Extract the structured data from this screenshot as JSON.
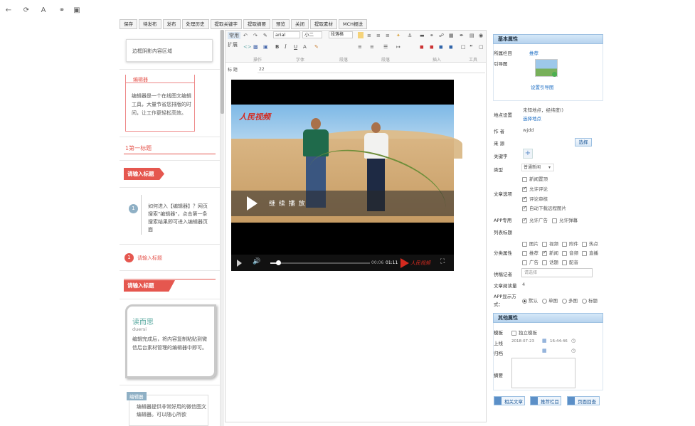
{
  "browser": {
    "icons": [
      "back-arrow-icon",
      "reload-icon",
      "font-icon",
      "link-icon",
      "save-icon"
    ]
  },
  "tabs": [
    "保存",
    "待发布",
    "发布",
    "处理历史",
    "提取关键字",
    "提取摘要",
    "预览",
    "关闭",
    "提取素材",
    "MCH报送"
  ],
  "left_panel": {
    "guide_area": "边框阴影内容区域",
    "editor_tag": "编辑器",
    "editor_desc": "编辑器是一个在线图文编辑工具，大量节省您排版的时间，让工作更轻松高效。",
    "first_title": "1第一标题",
    "input_title_1": "请输入标题",
    "step_num": "1",
    "step_text": "如何进入【编辑器】？网页搜索\"编辑器\"，点击第一条搜索结果即可进入编辑器页面",
    "num_title_num": "1",
    "num_title_text": "请输入标题",
    "input_title_2": "请输入标题",
    "card_title": "读而思",
    "card_sub": "duersi",
    "card_text": "编辑完成后，将内容复制粘贴到微信后台素材管理的编辑器中即可。",
    "last_tag": "编辑器",
    "last_text": "编辑器提供非常好用的微信图文编辑器。可以随心所欲"
  },
  "toolbar": {
    "mode_common": "常用",
    "mode_extend": "扩展",
    "font_family": "arial",
    "font_size": "小二",
    "paragraph": "段落格",
    "bold": "B",
    "italic": "I",
    "underline": "U",
    "font_color": "A",
    "groups": [
      "操作",
      "字体",
      "段落",
      "插入",
      "工具"
    ],
    "ruler_label": "标 题",
    "ruler_value": "22"
  },
  "video": {
    "brand": "人民视频",
    "play_label": "继 续 播 放",
    "time_current": "00:06",
    "time_total": "01:11",
    "progress": 0.08
  },
  "right_panel": {
    "basic_title": "基本属性",
    "column_label": "所属栏目",
    "column_value": "推荐",
    "guide_img_label": "引导图",
    "guide_img_btn": "设置引导图",
    "location_label": "地点设置",
    "location_value": "未知地点，经纬度()",
    "location_btn": "选择地点",
    "author_label": "作 者",
    "author_value": "wjdd",
    "source_label": "来 源",
    "source_btn": "选择",
    "keyword_label": "关键字",
    "keyword_add": "+",
    "type_label": "类型",
    "type_value": "普通新闻",
    "article_options_label": "文章选项",
    "article_options": [
      {
        "label": "新闻置顶",
        "checked": false
      },
      {
        "label": "允许评论",
        "checked": true
      },
      {
        "label": "评论审核",
        "checked": true
      },
      {
        "label": "自动下载远程图片",
        "checked": true
      }
    ],
    "app_label": "APP专用",
    "app_options": [
      {
        "label": "允许广告",
        "checked": true
      },
      {
        "label": "允许弹幕",
        "checked": false
      }
    ],
    "list_title_label": "列表标题",
    "category_label": "分类属性",
    "category_options": [
      {
        "label": "图片",
        "checked": false
      },
      {
        "label": "视频",
        "checked": false
      },
      {
        "label": "附件",
        "checked": false
      },
      {
        "label": "热点",
        "checked": false
      },
      {
        "label": "推荐",
        "checked": false
      },
      {
        "label": "新闻",
        "checked": true
      },
      {
        "label": "音频",
        "checked": false
      },
      {
        "label": "直播",
        "checked": false
      },
      {
        "label": "广告",
        "checked": false
      },
      {
        "label": "话题",
        "checked": false
      },
      {
        "label": "配音",
        "checked": false
      }
    ],
    "reporter_label": "供稿记者",
    "reporter_placeholder": "请选择",
    "read_count_label": "文章阅读量",
    "read_count_value": "4",
    "app_display_label": "APP显示方式：",
    "app_display_options": [
      {
        "label": "默认",
        "checked": true
      },
      {
        "label": "单图",
        "checked": false
      },
      {
        "label": "多图",
        "checked": false
      },
      {
        "label": "标题",
        "checked": false
      }
    ],
    "other_title": "其他属性",
    "template_label": "模板",
    "template_option": "独立模板",
    "online_label": "上线",
    "online_date": "2018-07-23",
    "online_time": "16:44:46",
    "archive_label": "归档",
    "summary_label": "摘要",
    "bottom_buttons": [
      "相关文章",
      "推荐栏目",
      "页面回查"
    ]
  }
}
